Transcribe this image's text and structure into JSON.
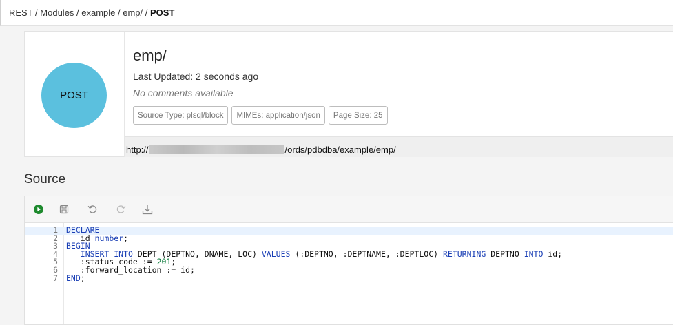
{
  "breadcrumb": {
    "items": [
      "REST",
      "Modules",
      "example",
      "emp/"
    ],
    "current": "POST",
    "separator": " / "
  },
  "handler": {
    "method": "POST",
    "method_color": "#5bc0de",
    "title": "emp/",
    "last_updated": "Last Updated: 2 seconds ago",
    "comments": "No comments available",
    "tags": [
      "Source Type: plsql/block",
      "MIMEs: application/json",
      "Page Size: 25"
    ],
    "url_prefix": "http://",
    "url_suffix": "/ords/pdbdba/example/emp/"
  },
  "source": {
    "title": "Source",
    "toolbar": [
      "run-icon",
      "save-icon",
      "undo-icon",
      "redo-icon",
      "download-icon"
    ],
    "lines": [
      {
        "n": "1",
        "parts": [
          {
            "t": "DECLARE",
            "c": "kw"
          }
        ]
      },
      {
        "n": "2",
        "parts": [
          {
            "t": "   id ",
            "c": ""
          },
          {
            "t": "number",
            "c": "kw"
          },
          {
            "t": ";",
            "c": ""
          }
        ]
      },
      {
        "n": "3",
        "parts": [
          {
            "t": "BEGIN",
            "c": "kw"
          }
        ]
      },
      {
        "n": "4",
        "parts": [
          {
            "t": "   INSERT INTO",
            "c": "kw"
          },
          {
            "t": " DEPT (DEPTNO, DNAME, LOC) ",
            "c": ""
          },
          {
            "t": "VALUES",
            "c": "kw"
          },
          {
            "t": " (:DEPTNO, :DEPTNAME, :DEPTLOC) ",
            "c": ""
          },
          {
            "t": "RETURNING",
            "c": "kw"
          },
          {
            "t": " DEPTNO ",
            "c": ""
          },
          {
            "t": "INTO",
            "c": "kw"
          },
          {
            "t": " id;",
            "c": ""
          }
        ]
      },
      {
        "n": "5",
        "parts": [
          {
            "t": "   :status_code := ",
            "c": ""
          },
          {
            "t": "201",
            "c": "num"
          },
          {
            "t": ";",
            "c": ""
          }
        ]
      },
      {
        "n": "6",
        "parts": [
          {
            "t": "   :forward_location := id;",
            "c": ""
          }
        ]
      },
      {
        "n": "7",
        "parts": [
          {
            "t": "END",
            "c": "kw"
          },
          {
            "t": ";",
            "c": ""
          }
        ]
      }
    ]
  }
}
